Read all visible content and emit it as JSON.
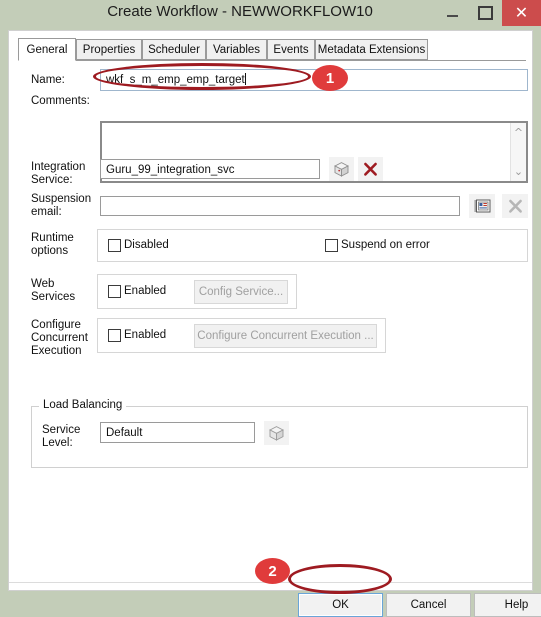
{
  "window": {
    "title": "Create Workflow - NEWWORKFLOW10",
    "minimize_label": "–",
    "maximize_label": "□",
    "close_label": "✕"
  },
  "tabs": [
    {
      "label": "General",
      "active": true
    },
    {
      "label": "Properties",
      "active": false
    },
    {
      "label": "Scheduler",
      "active": false
    },
    {
      "label": "Variables",
      "active": false
    },
    {
      "label": "Events",
      "active": false
    },
    {
      "label": "Metadata Extensions",
      "active": false
    }
  ],
  "form": {
    "name": {
      "label": "Name:",
      "value": "wkf_s_m_emp_emp_target"
    },
    "comments": {
      "label": "Comments:",
      "value": ""
    },
    "integration_service": {
      "label": "Integration\nService:",
      "value": "Guru_99_integration_svc"
    },
    "suspension_email": {
      "label": "Suspension\nemail:",
      "value": ""
    },
    "runtime_options": {
      "label": "Runtime\noptions",
      "disabled": {
        "label": "Disabled",
        "checked": false
      },
      "suspend_on_error": {
        "label": "Suspend on error",
        "checked": false
      }
    },
    "web_services": {
      "label": "Web\nServices",
      "enabled": {
        "label": "Enabled",
        "checked": false
      },
      "config_button": "Config Service..."
    },
    "concurrent_execution": {
      "label": "Configure\nConcurrent\nExecution",
      "enabled": {
        "label": "Enabled",
        "checked": false
      },
      "config_button": "Configure Concurrent Execution ..."
    },
    "load_balancing": {
      "legend": "Load Balancing",
      "service_level": {
        "label": "Service\nLevel:",
        "value": "Default"
      }
    }
  },
  "icons": {
    "integration_browse": "cube-icon",
    "integration_clear": "red-x-icon",
    "suspension_addressbook": "address-book-icon",
    "suspension_clear": "gray-x-icon",
    "service_level_browse": "cube-icon",
    "scroll_up": "chevron-up-icon",
    "scroll_down": "chevron-down-icon"
  },
  "footer": {
    "ok": "OK",
    "cancel": "Cancel",
    "help": "Help"
  },
  "annotations": [
    {
      "id": "badge-1",
      "label": "1"
    },
    {
      "id": "badge-2",
      "label": "2"
    }
  ],
  "colors": {
    "titlebar": "#c3cdb8",
    "close_button": "#cc4c4c",
    "annotation_ring": "#9e1b21",
    "annotation_badge": "#e03b3b",
    "focus_border": "#6aa5d8"
  }
}
